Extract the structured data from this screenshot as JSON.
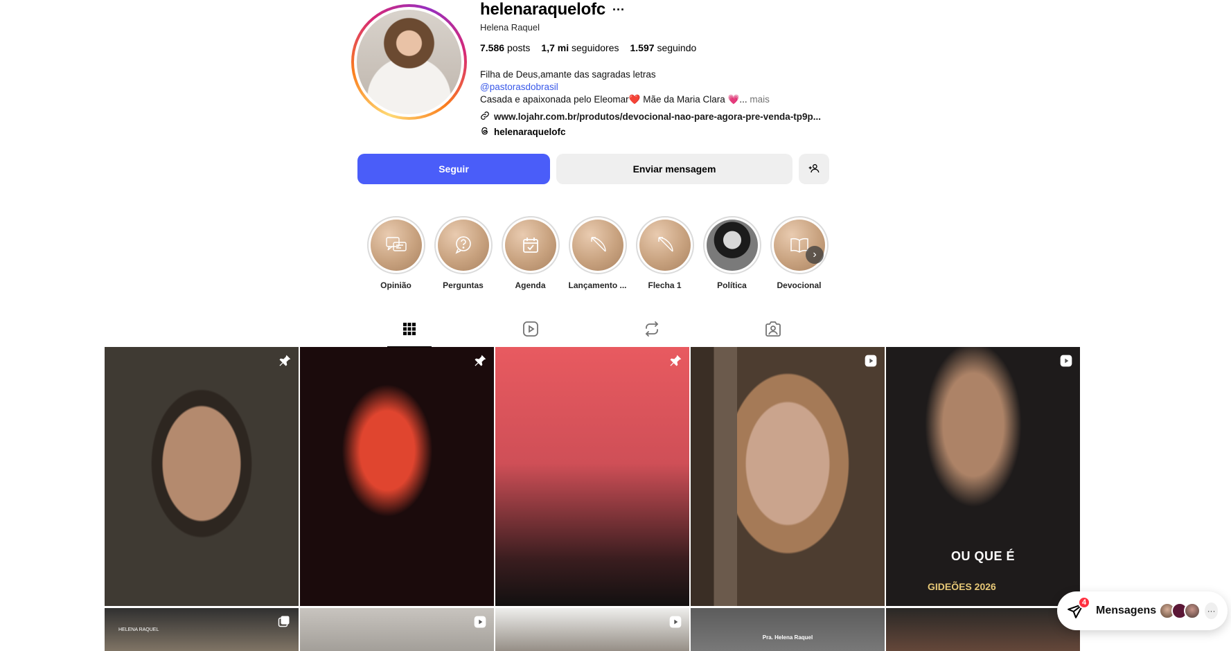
{
  "profile": {
    "username": "helenaraquelofc",
    "options_label": "···",
    "full_name": "Helena Raquel",
    "stats": [
      {
        "value": "7.586",
        "label": "posts"
      },
      {
        "value": "1,7 mi",
        "label": "seguidores"
      },
      {
        "value": "1.597",
        "label": "seguindo"
      }
    ],
    "bio_line1": "Filha de Deus,amante das sagradas letras",
    "bio_mention": "@pastorasdobrasil",
    "bio_line3": "Casada e apaixonada pelo Eleomar❤️  Mãe da Maria Clara 💗...",
    "bio_more": "mais",
    "link": "www.lojahr.com.br/produtos/devocional-nao-pare-agora-pre-venda-tp9p...",
    "threads_handle": "helenaraquelofc"
  },
  "actions": {
    "follow": "Seguir",
    "message": "Enviar mensagem"
  },
  "highlights": [
    {
      "label": "Opinião",
      "icon": "chat-icon"
    },
    {
      "label": "Perguntas",
      "icon": "question-icon"
    },
    {
      "label": "Agenda",
      "icon": "calendar-icon"
    },
    {
      "label": "Lançamento ...",
      "icon": "bow-arrow-icon"
    },
    {
      "label": "Flecha 1",
      "icon": "bow-arrow-icon"
    },
    {
      "label": "Política",
      "icon": "photo"
    },
    {
      "label": "Devocional",
      "icon": "book-icon"
    }
  ],
  "tabs": [
    "posts-grid",
    "reels",
    "reposts",
    "tagged"
  ],
  "grid_captions": {
    "post5_caption": "OU QUE É",
    "post5_logo": "GIDEÕES 2026",
    "post6_watermark": "HELENA RAQUEL",
    "post9_watermark": "Pra. Helena Raquel"
  },
  "messages": {
    "label": "Mensagens",
    "unread_count": "4"
  },
  "colors": {
    "follow_button": "#4a5df9",
    "secondary_button": "#efefef",
    "mention": "#3858e9",
    "badge": "#ff3040"
  }
}
